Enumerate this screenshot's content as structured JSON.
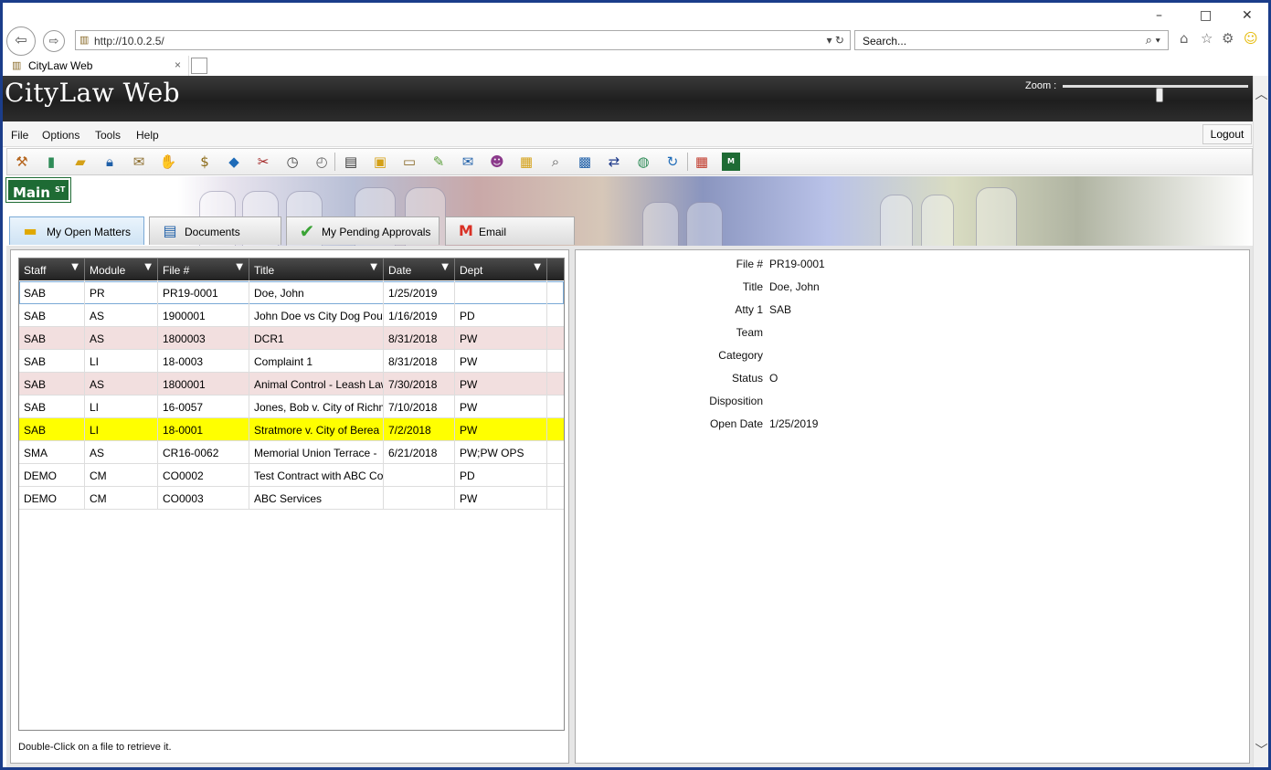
{
  "browser": {
    "address": "http://10.0.2.5/",
    "search_placeholder": "Search...",
    "tab_title": "CityLaw Web",
    "tab_close": "×",
    "window_controls": {
      "minimize": "–",
      "maximize": "□",
      "close": "✕"
    }
  },
  "app": {
    "title": "CityLaw Web",
    "zoom_label": "Zoom :",
    "zoom_level": 0.52
  },
  "menu": {
    "items": [
      "File",
      "Options",
      "Tools",
      "Help"
    ],
    "logout": "Logout"
  },
  "toolbar": {
    "icons": [
      "gavel-icon",
      "notebook-icon",
      "folder-notes-icon",
      "lock-icon",
      "hand-deliver-icon",
      "handshake-icon",
      "money-bag-icon",
      "tag-icon",
      "tools-icon",
      "stopwatch-icon",
      "clock-icon",
      "printer-icon",
      "padlock-icon",
      "file-folder-icon",
      "pen-icon",
      "envelope-icon",
      "people-icon",
      "clipboard-icon",
      "search-doc-icon",
      "contact-card-icon",
      "transfer-arrows-icon",
      "globe-icon",
      "refresh-icon",
      "dashboard-icon",
      "main-st-icon"
    ]
  },
  "banner": {
    "sign_text": "Main",
    "sign_sup": "ST"
  },
  "tabs": [
    {
      "label": "My Open Matters",
      "icon": "folder-icon",
      "active": true
    },
    {
      "label": "Documents",
      "icon": "document-icon",
      "active": false
    },
    {
      "label": "My Pending Approvals",
      "icon": "checkmark-icon",
      "active": false
    },
    {
      "label": "Email",
      "icon": "gmail-icon",
      "active": false
    }
  ],
  "grid": {
    "columns": [
      "Staff",
      "Module",
      "File #",
      "Title",
      "Date",
      "Dept"
    ],
    "rows": [
      {
        "cells": [
          "SAB",
          "PR",
          "PR19-0001",
          "Doe, John",
          "1/25/2019",
          ""
        ],
        "style": "selected"
      },
      {
        "cells": [
          "SAB",
          "AS",
          "1900001",
          "John Doe vs City Dog Poun",
          "1/16/2019",
          "PD"
        ],
        "style": ""
      },
      {
        "cells": [
          "SAB",
          "AS",
          "1800003",
          "DCR1",
          "8/31/2018",
          "PW"
        ],
        "style": "pink"
      },
      {
        "cells": [
          "SAB",
          "LI",
          "18-0003",
          "Complaint 1",
          "8/31/2018",
          "PW"
        ],
        "style": ""
      },
      {
        "cells": [
          "SAB",
          "AS",
          "1800001",
          "Animal Control - Leash Law",
          "7/30/2018",
          "PW"
        ],
        "style": "pink"
      },
      {
        "cells": [
          "SAB",
          "LI",
          "16-0057",
          "Jones, Bob v. City of Richm",
          "7/10/2018",
          "PW"
        ],
        "style": ""
      },
      {
        "cells": [
          "SAB",
          "LI",
          "18-0001",
          "Stratmore v. City of Berea",
          "7/2/2018",
          "PW"
        ],
        "style": "yellow"
      },
      {
        "cells": [
          "SMA",
          "AS",
          "CR16-0062",
          "Memorial Union Terrace -",
          "6/21/2018",
          "PW;PW OPS"
        ],
        "style": ""
      },
      {
        "cells": [
          "DEMO",
          "CM",
          "CO0002",
          "Test Contract with ABC Co",
          "",
          "PD"
        ],
        "style": ""
      },
      {
        "cells": [
          "DEMO",
          "CM",
          "CO0003",
          "ABC Services",
          "",
          "PW"
        ],
        "style": ""
      }
    ],
    "status": "Double-Click on a file to retrieve it."
  },
  "details": [
    {
      "label": "File #",
      "value": "PR19-0001"
    },
    {
      "label": "Title",
      "value": "Doe, John"
    },
    {
      "label": "Atty 1",
      "value": "SAB"
    },
    {
      "label": "Team",
      "value": ""
    },
    {
      "label": "Category",
      "value": ""
    },
    {
      "label": "Status",
      "value": "O"
    },
    {
      "label": "Disposition",
      "value": ""
    },
    {
      "label": "Open Date",
      "value": "1/25/2019"
    }
  ],
  "colors": {
    "window_border": "#1b3d8a",
    "header_dark": "#222222",
    "row_pink": "#f2dfdf",
    "row_yellow": "#ffff00",
    "sign_green": "#1e6b34"
  }
}
